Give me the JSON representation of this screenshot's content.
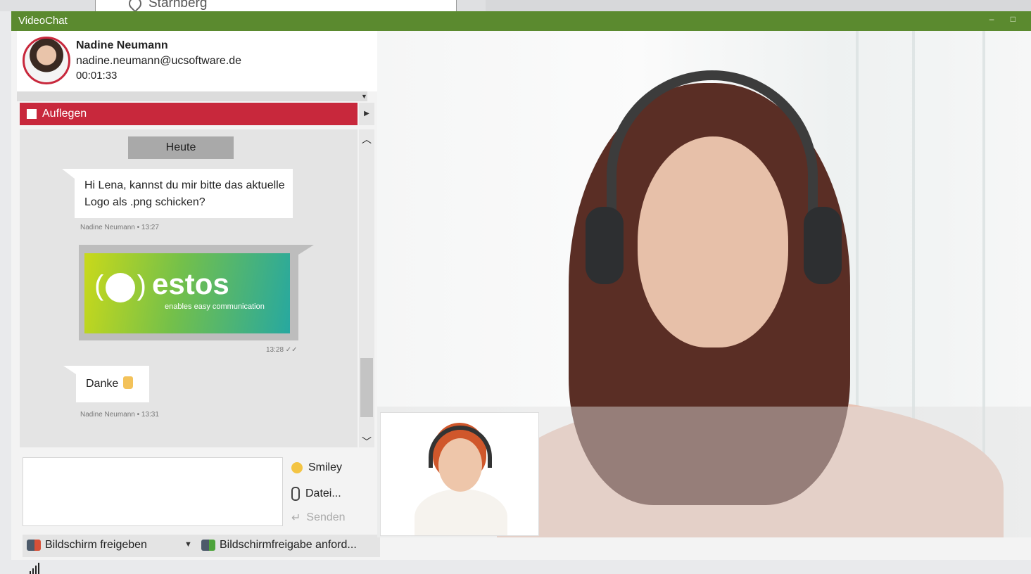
{
  "background": {
    "location": "Starnberg"
  },
  "window": {
    "title": "VideoChat",
    "controls": [
      "–",
      "□"
    ],
    "accent": "#5b8a2f"
  },
  "contact": {
    "name": "Nadine Neumann",
    "email": "nadine.neumann@ucsoftware.de",
    "duration": "00:01:33"
  },
  "hangup": {
    "label": "Auflegen",
    "color": "#c8283c"
  },
  "chat": {
    "date": "Heute",
    "messages": [
      {
        "text": "Hi Lena, kannst du mir bitte das aktuelle Logo als .png schicken?",
        "meta": "Nadine Neumann • 13:27"
      },
      {
        "image_logo": "estos",
        "image_tagline": "enables easy communication",
        "meta": "13:28 ✓✓"
      },
      {
        "text": "Danke",
        "meta": "Nadine Neumann • 13:31"
      }
    ]
  },
  "tools": {
    "smiley": "Smiley",
    "file": "Datei...",
    "send": "Senden"
  },
  "share": {
    "screen_share": "Bildschirm freigeben",
    "request_share": "Bildschirmfreigabe anford..."
  },
  "icons": [
    "map-pin-icon",
    "stop-icon",
    "chevron-right-icon",
    "chevron-up-icon",
    "chevron-down-icon",
    "smiley-icon",
    "paperclip-icon",
    "send-icon",
    "screen-share-icon",
    "request-share-icon",
    "signal-icon"
  ]
}
